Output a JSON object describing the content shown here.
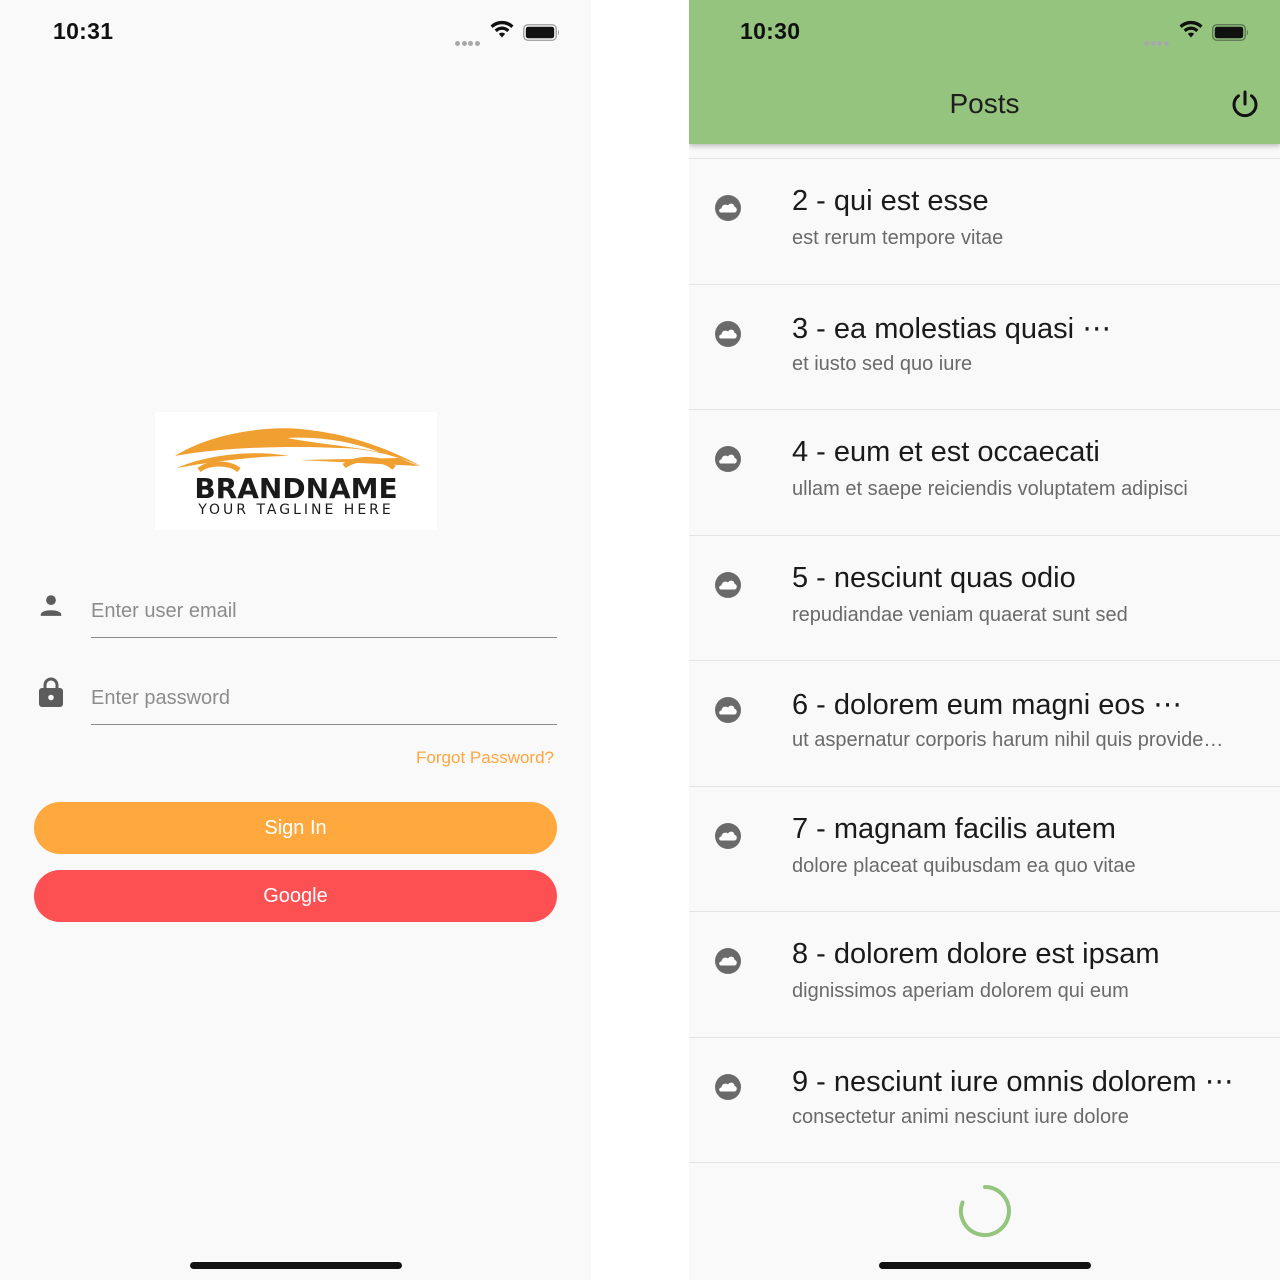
{
  "login": {
    "status_time": "10:31",
    "logo": {
      "brand": "BRANDNAME",
      "tagline": "YOUR TAGLINE HERE"
    },
    "email_placeholder": "Enter user email",
    "password_placeholder": "Enter password",
    "forgot_label": "Forgot Password?",
    "signin_label": "Sign In",
    "google_label": "Google",
    "colors": {
      "signin": "#ffa83d",
      "google": "#fd5052",
      "forgot": "#ffa63e",
      "logo_car": "#f0a030"
    }
  },
  "posts": {
    "status_time": "10:30",
    "title": "Posts",
    "appbar_color": "#94c47e",
    "action_icon": "power-icon",
    "item_icon": "cloud-icon",
    "items": [
      {
        "title": "2 - qui est esse",
        "subtitle": "est rerum tempore vitae"
      },
      {
        "title": "3 - ea molestias quasi ⋯",
        "subtitle": "et iusto sed quo iure"
      },
      {
        "title": "4 - eum et est occaecati",
        "subtitle": "ullam et saepe reiciendis voluptatem adipisci"
      },
      {
        "title": "5 - nesciunt quas odio",
        "subtitle": "repudiandae veniam quaerat sunt sed"
      },
      {
        "title": "6 - dolorem eum magni eos ⋯",
        "subtitle": "ut aspernatur corporis harum nihil quis provide…"
      },
      {
        "title": "7 - magnam facilis autem",
        "subtitle": "dolore placeat quibusdam ea quo vitae"
      },
      {
        "title": "8 - dolorem dolore est ipsam",
        "subtitle": "dignissimos aperiam dolorem qui eum"
      },
      {
        "title": "9 - nesciunt iure omnis dolorem ⋯",
        "subtitle": "consectetur animi nesciunt iure dolore"
      }
    ]
  }
}
